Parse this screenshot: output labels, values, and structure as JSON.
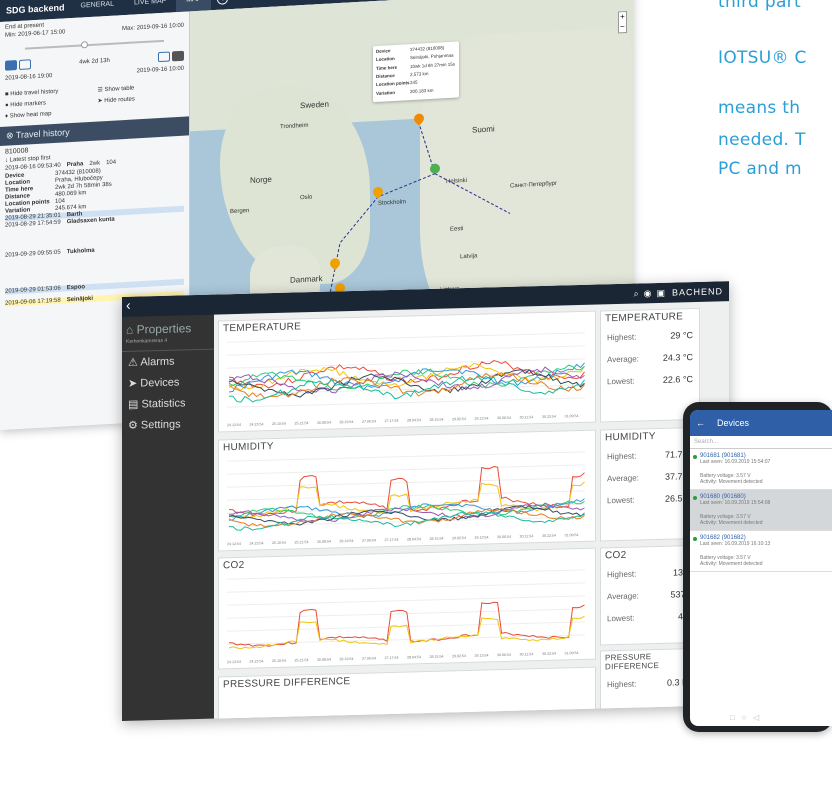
{
  "marketing": {
    "line1": "third part",
    "line2": "IOTSU® C",
    "line3": "means th",
    "line4": "needed. T",
    "line5": "PC and m"
  },
  "back_window": {
    "logo": "SDG backend",
    "tabs": [
      "GENERAL",
      "LIVE MAP",
      "MAP"
    ],
    "end_label": "End at present",
    "min_date": "Min: 2019-06-17 15:00",
    "max_date": "Max: 2019-09-16 10:00",
    "duration": "4wk 2d 13h",
    "date_from": "2019-08-16 19:00",
    "date_to": "2019-09-16 10:00",
    "options": [
      "Hide travel history",
      "Show table",
      "Hide markers",
      "Hide routes",
      "Show heat map"
    ],
    "travel_title": "Travel history",
    "device_id": "810008",
    "latest_first": "Latest stop first",
    "entries": [
      {
        "time": "2019-08-16 09:53:40",
        "place": "Praha",
        "dur": "2wk",
        "count": "104"
      },
      {
        "time": "2019-08-29 21:35:01",
        "place": "Barth",
        "dur": "",
        "count": "1"
      },
      {
        "time": "2019-08-29 17:54:59",
        "place": "Gladsaxen kunta",
        "dur": "",
        "count": "1"
      },
      {
        "time": "2019-09-29 09:55:05",
        "place": "Tukholma",
        "dur": "",
        "count": ""
      },
      {
        "time": "2019-09-29 01:53:06",
        "place": "Espoo",
        "dur": "",
        "count": ""
      },
      {
        "time": "2019-09-06 17:19:58",
        "place": "Seinäjoki",
        "dur": "",
        "count": ""
      }
    ],
    "detail": [
      [
        "Device",
        "374432 (810008)"
      ],
      [
        "Location",
        "Praha, Hlubočepy"
      ],
      [
        "Time here",
        "2wk 2d 7h 58min 38s"
      ],
      [
        "Distance",
        "480.069 km"
      ],
      [
        "Location points",
        "104"
      ],
      [
        "Variation",
        "245.674 km"
      ]
    ],
    "popup": [
      [
        "Device",
        "374432 (810008)"
      ],
      [
        "Location",
        "Seinäjoki, Pohjanmaa"
      ],
      [
        "Time here",
        "10wk 1d 6h 27min 15s"
      ],
      [
        "Distance",
        "2,573 km"
      ],
      [
        "Location points",
        "245"
      ],
      [
        "Variation",
        "200.183 km"
      ]
    ],
    "map_labels": [
      "Sweden",
      "Suomi",
      "Norge",
      "Helsinki",
      "Stockholm",
      "Danmark",
      "Eesti",
      "Latvija",
      "Lietuva",
      "Trondheim",
      "Bergen",
      "Oslo",
      "Санкт-Петербург"
    ]
  },
  "front_window": {
    "sidebar": {
      "properties": "Properties",
      "subtitle": "Kerhonkamreras 4",
      "items": [
        "Alarms",
        "Devices",
        "Statistics",
        "Settings"
      ]
    },
    "header_brand": "BACHEND",
    "charts": [
      {
        "title": "TEMPERATURE"
      },
      {
        "title": "HUMIDITY"
      },
      {
        "title": "CO2"
      },
      {
        "title": "PRESSURE DIFFERENCE"
      }
    ],
    "x_ticks": [
      "24.12:54",
      "24.23:54",
      "25.10:54",
      "25.21:54",
      "26.08:54",
      "26.19:54",
      "27.06:54",
      "27.17:54",
      "28.04:54",
      "28.15:54",
      "29.02:54",
      "29.13:54",
      "30.00:54",
      "30.11:54",
      "30.22:54",
      "31.09:54"
    ],
    "stats": [
      {
        "title": "TEMPERATURE",
        "highest": "29 °C",
        "average": "24.3 °C",
        "lowest": "22.6 °C"
      },
      {
        "title": "HUMIDITY",
        "highest": "71.7 %",
        "average": "37.7 %",
        "lowest": "26.5 %"
      },
      {
        "title": "CO2",
        "highest": "1320",
        "average": "537.4",
        "lowest": "400"
      },
      {
        "title": "PRESSURE DIFFERENCE",
        "highest": "0.3 Pa"
      }
    ],
    "stat_labels": {
      "highest": "Highest:",
      "average": "Average:",
      "lowest": "Lowest:"
    }
  },
  "phone": {
    "title": "Devices",
    "search_placeholder": "Search...",
    "devices": [
      {
        "name": "901681 (901681)",
        "seen": "Last seen: 16.09.2019 15:54:07",
        "battery": "Battery voltage: 3.57 V",
        "activity": "Activity: Movement detected"
      },
      {
        "name": "901680 (901680)",
        "seen": "Last seen: 16.09.2019 15:54:08",
        "battery": "Battery voltage: 3.57 V",
        "activity": "Activity: Movement detected"
      },
      {
        "name": "901682 (901682)",
        "seen": "Last seen: 16.09.2019 16:10:13",
        "battery": "Battery voltage: 3.57 V",
        "activity": "Activity: Movement detected"
      }
    ]
  },
  "colors": {
    "accent": "#2a9fd6",
    "navy": "#1f2f44",
    "phone_header": "#2f5fa7"
  }
}
